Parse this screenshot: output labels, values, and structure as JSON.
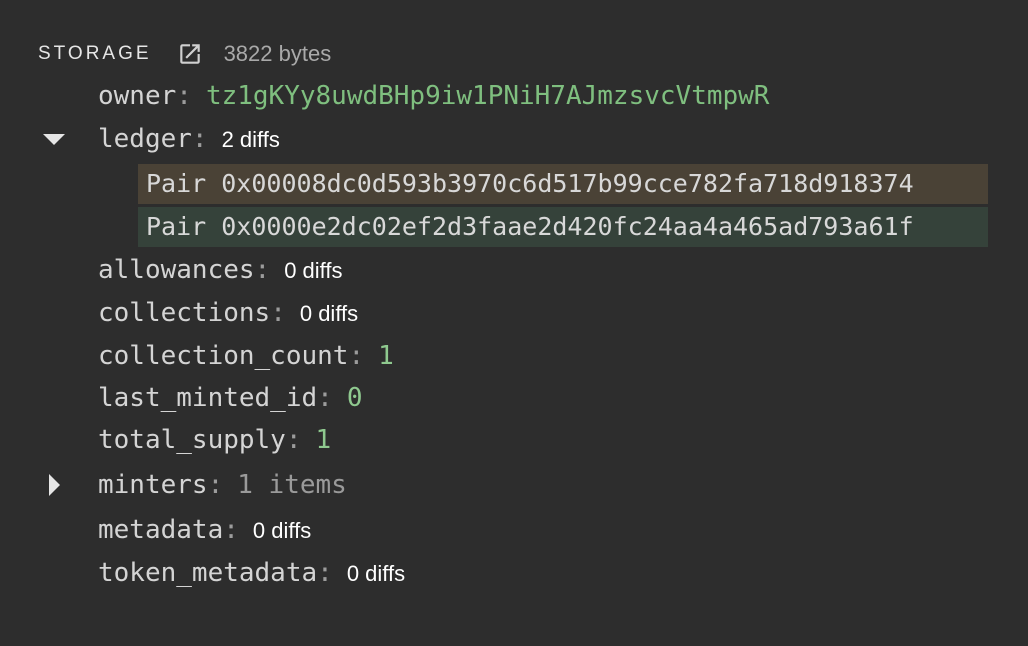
{
  "header": {
    "title": "STORAGE",
    "size": "3822 bytes"
  },
  "storage": {
    "owner": {
      "key": "owner",
      "value": "tz1gKYy8uwdBHp9iw1PNiH7AJmzsvcVtmpwR"
    },
    "ledger": {
      "key": "ledger",
      "diffs": "2 diffs"
    },
    "ledger_pairs": [
      {
        "text": "Pair 0x00008dc0d593b3970c6d517b99cce782fa718d918374",
        "status": "changed",
        "color": "#4a4236"
      },
      {
        "text": "Pair 0x0000e2dc02ef2d3faae2d420fc24aa4a465ad793a61f",
        "status": "added",
        "color": "#35423a"
      }
    ],
    "allowances": {
      "key": "allowances",
      "diffs": "0 diffs"
    },
    "collections": {
      "key": "collections",
      "diffs": "0 diffs"
    },
    "collection_count": {
      "key": "collection_count",
      "value": "1"
    },
    "last_minted_id": {
      "key": "last_minted_id",
      "value": "0"
    },
    "total_supply": {
      "key": "total_supply",
      "value": "1"
    },
    "minters": {
      "key": "minters",
      "value": "1 items"
    },
    "metadata": {
      "key": "metadata",
      "diffs": "0 diffs"
    },
    "token_metadata": {
      "key": "token_metadata",
      "diffs": "0 diffs"
    }
  },
  "colors": {
    "background": "#2d2d2d",
    "address_value": "#7fbf7f",
    "number_value": "#8fc98f"
  },
  "icons": {
    "open_external": "open-external-icon",
    "expanded": "caret-down-icon",
    "collapsed": "caret-right-icon"
  }
}
